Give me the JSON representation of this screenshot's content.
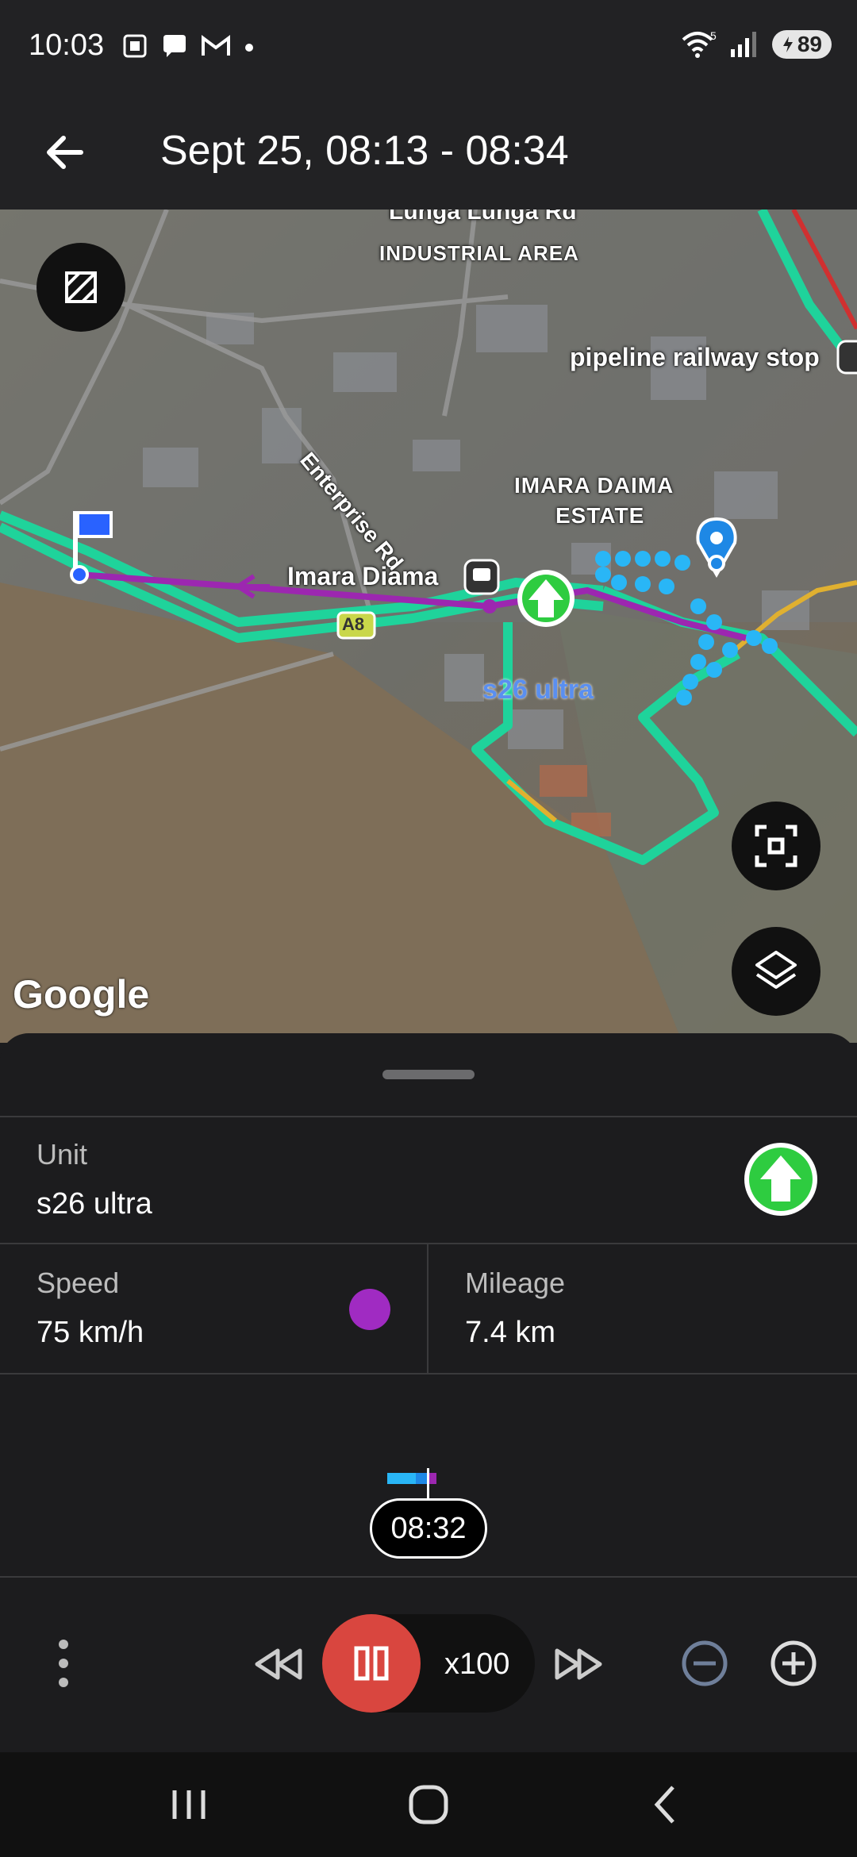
{
  "status_bar": {
    "time": "10:03",
    "battery": "89",
    "wifi_badge": "5"
  },
  "app_bar": {
    "title": "Sept 25, 08:13 - 08:34"
  },
  "map": {
    "labels": {
      "top_road": "Lunga Lunga Rd",
      "industrial_area": "INDUSTRIAL AREA",
      "pipeline_stop": "pipeline railway stop",
      "enterprise_rd": "Enterprise Rd",
      "imara_estate_1": "IMARA DAIMA",
      "imara_estate_2": "ESTATE",
      "imara_station": "Imara Diama",
      "road_shield": "A8",
      "unit_name": "s26 ultra",
      "attribution": "Google"
    },
    "colors": {
      "route_green": "#1fd39b",
      "track_purple": "#9c27b0",
      "track_blue": "#29b6f6",
      "pin_blue": "#1e88e5"
    }
  },
  "sheet": {
    "unit_label": "Unit",
    "unit_value": "s26 ultra",
    "speed_label": "Speed",
    "speed_value": "75 km/h",
    "speed_color": "#a02bc2",
    "mileage_label": "Mileage",
    "mileage_value": "7.4 km",
    "current_time": "08:32"
  },
  "controls": {
    "speed_multiplier": "x100",
    "pause_color": "#d9463f"
  }
}
